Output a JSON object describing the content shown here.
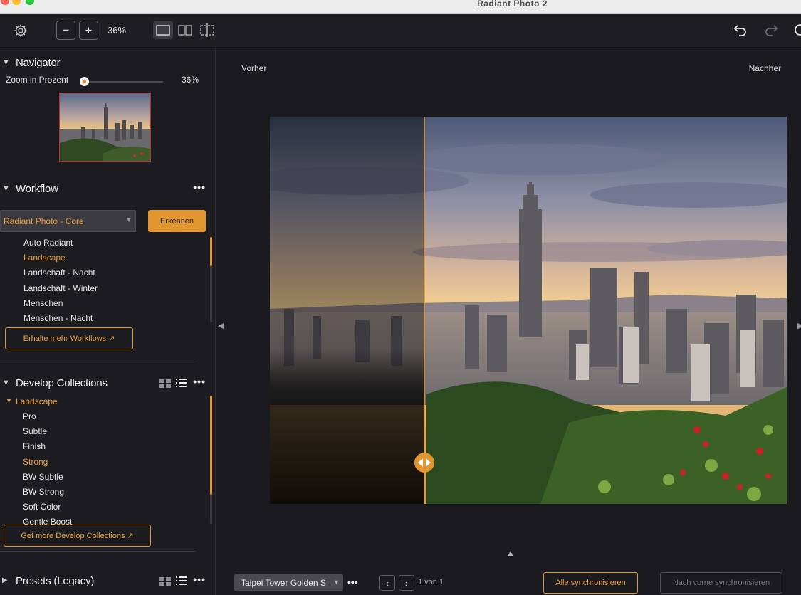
{
  "window": {
    "title": "Radiant Photo 2"
  },
  "toolbar": {
    "settings_icon": "gear-icon",
    "zoom_out": "−",
    "zoom_in": "+",
    "zoom_value": "36%",
    "view_modes": [
      "single-view-icon",
      "side-by-side-icon",
      "split-view-icon"
    ],
    "undo_icon": "undo-icon",
    "redo_icon": "redo-icon"
  },
  "navigator": {
    "title": "Navigator",
    "zoom_label": "Zoom in Prozent",
    "zoom_percent": "36%",
    "zoom_fraction": 0.02
  },
  "workflow": {
    "title": "Workflow",
    "more": "•••",
    "dropdown_value": "Radiant Photo - Core",
    "detect_button": "Erkennen",
    "items": [
      {
        "label": "Auto Radiant",
        "selected": false
      },
      {
        "label": "Landscape",
        "selected": true
      },
      {
        "label": "Landschaft - Nacht",
        "selected": false
      },
      {
        "label": "Landschaft - Winter",
        "selected": false
      },
      {
        "label": "Menschen",
        "selected": false
      },
      {
        "label": "Menschen - Nacht",
        "selected": false
      }
    ],
    "more_button": "Erhalte mehr Workflows"
  },
  "develop": {
    "title": "Develop Collections",
    "more": "•••",
    "group": "Landscape",
    "items": [
      {
        "label": "Pro",
        "selected": false
      },
      {
        "label": "Subtle",
        "selected": false
      },
      {
        "label": "Finish",
        "selected": false
      },
      {
        "label": "Strong",
        "selected": true
      },
      {
        "label": "BW Subtle",
        "selected": false
      },
      {
        "label": "BW Strong",
        "selected": false
      },
      {
        "label": "Soft Color",
        "selected": false
      },
      {
        "label": "Gentle Boost",
        "selected": false
      }
    ],
    "more_button": "Get more Develop Collections"
  },
  "presets": {
    "title": "Presets (Legacy)",
    "more": "•••"
  },
  "viewer": {
    "before_label": "Vorher",
    "after_label": "Nachher",
    "split_fraction": 0.3
  },
  "bottom": {
    "file_select": "Taipei Tower Golden S",
    "more": "•••",
    "page_info": "1 von 1",
    "sync_all": "Alle synchronisieren",
    "sync_forward": "Nach vorne synchronisieren"
  },
  "colors": {
    "accent": "#e2962f",
    "panel": "#1d1c21",
    "background": "#1b1a1f"
  }
}
